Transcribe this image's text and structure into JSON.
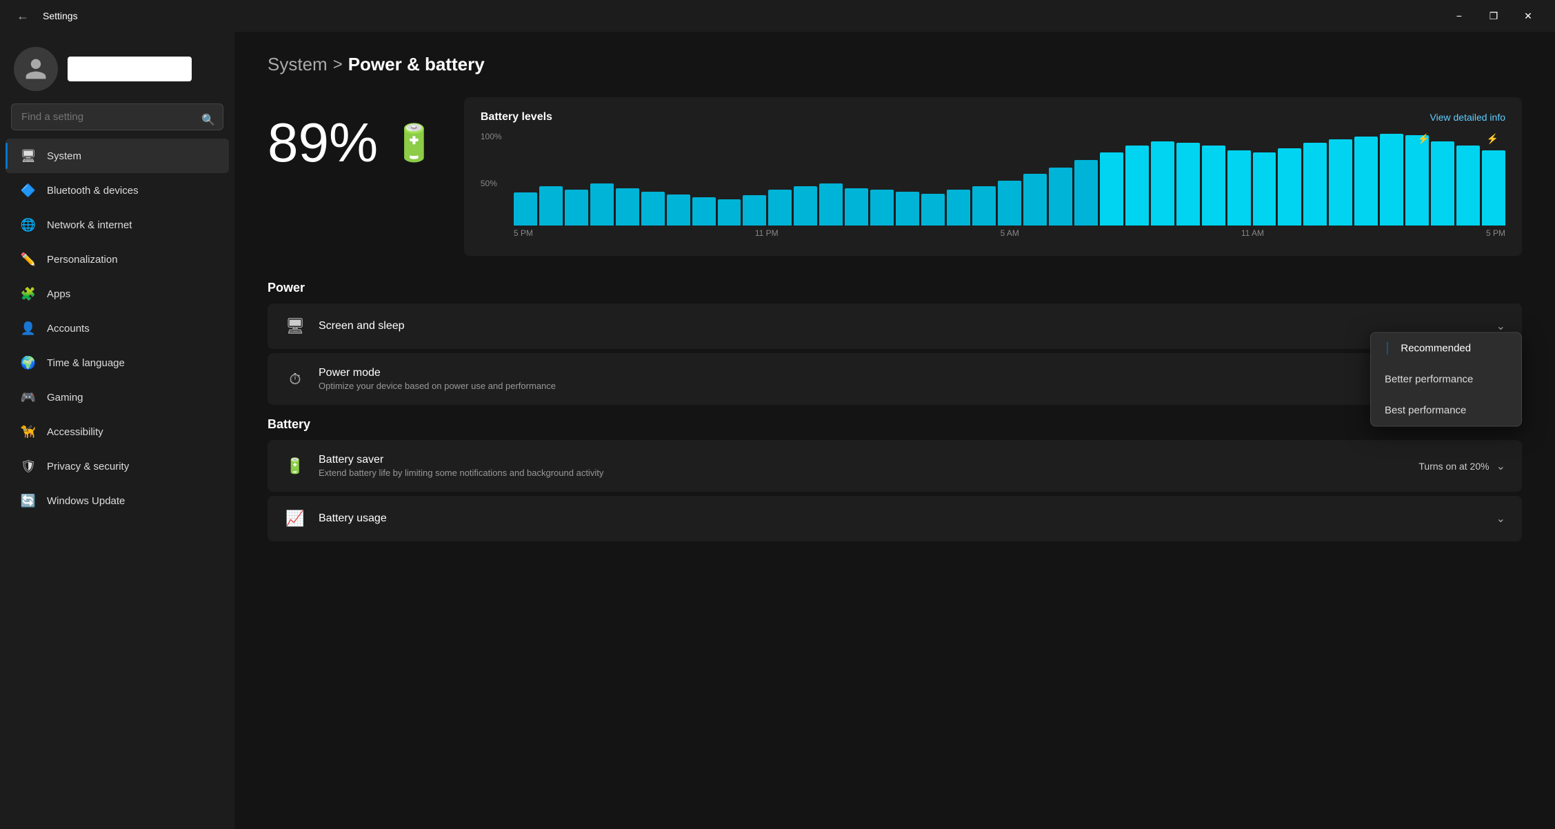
{
  "titlebar": {
    "title": "Settings",
    "minimize_label": "−",
    "maximize_label": "❐",
    "close_label": "✕"
  },
  "sidebar": {
    "search_placeholder": "Find a setting",
    "user_name": "",
    "nav_items": [
      {
        "id": "system",
        "label": "System",
        "icon": "🖥",
        "active": true
      },
      {
        "id": "bluetooth",
        "label": "Bluetooth & devices",
        "icon": "🔷",
        "active": false
      },
      {
        "id": "network",
        "label": "Network & internet",
        "icon": "🌐",
        "active": false
      },
      {
        "id": "personalization",
        "label": "Personalization",
        "icon": "✏️",
        "active": false
      },
      {
        "id": "apps",
        "label": "Apps",
        "icon": "🧩",
        "active": false
      },
      {
        "id": "accounts",
        "label": "Accounts",
        "icon": "👤",
        "active": false
      },
      {
        "id": "time",
        "label": "Time & language",
        "icon": "🌍",
        "active": false
      },
      {
        "id": "gaming",
        "label": "Gaming",
        "icon": "🎮",
        "active": false
      },
      {
        "id": "accessibility",
        "label": "Accessibility",
        "icon": "🦮",
        "active": false
      },
      {
        "id": "privacy",
        "label": "Privacy & security",
        "icon": "🛡",
        "active": false
      },
      {
        "id": "windows-update",
        "label": "Windows Update",
        "icon": "🔄",
        "active": false
      }
    ]
  },
  "content": {
    "breadcrumb_parent": "System",
    "breadcrumb_sep": ">",
    "breadcrumb_current": "Power & battery",
    "battery_percent": "89%",
    "chart": {
      "title": "Battery levels",
      "link": "View detailed info",
      "y_labels": [
        "100%",
        "50%",
        ""
      ],
      "x_labels": [
        "5 PM",
        "11 PM",
        "5 AM",
        "11 AM",
        "5 PM"
      ],
      "bars": [
        35,
        42,
        38,
        45,
        40,
        36,
        33,
        30,
        28,
        32,
        38,
        42,
        45,
        40,
        38,
        36,
        34,
        38,
        42,
        48,
        55,
        62,
        70,
        78,
        85,
        90,
        88,
        85,
        80,
        78,
        82,
        88,
        92,
        95,
        98,
        96,
        90,
        85,
        80
      ],
      "charge_pins": [
        {
          "pos": 0.92,
          "icon": "⚡"
        },
        {
          "pos": 1.0,
          "icon": "⚡"
        }
      ]
    },
    "power_section_title": "Power",
    "screen_sleep": {
      "title": "Screen and sleep",
      "icon": "🖥"
    },
    "power_mode": {
      "title": "Power mode",
      "subtitle": "Optimize your device based on power use and performance",
      "icon": "⚡",
      "dropdown": {
        "options": [
          {
            "id": "recommended",
            "label": "Recommended",
            "selected": true
          },
          {
            "id": "better-performance",
            "label": "Better performance",
            "selected": false
          },
          {
            "id": "best-performance",
            "label": "Best performance",
            "selected": false
          }
        ]
      }
    },
    "battery_section_title": "Battery",
    "battery_saver": {
      "title": "Battery saver",
      "subtitle": "Extend battery life by limiting some notifications and background activity",
      "icon": "🔋",
      "control": "Turns on at 20%"
    },
    "battery_usage": {
      "title": "Battery usage",
      "icon": "📊"
    }
  }
}
